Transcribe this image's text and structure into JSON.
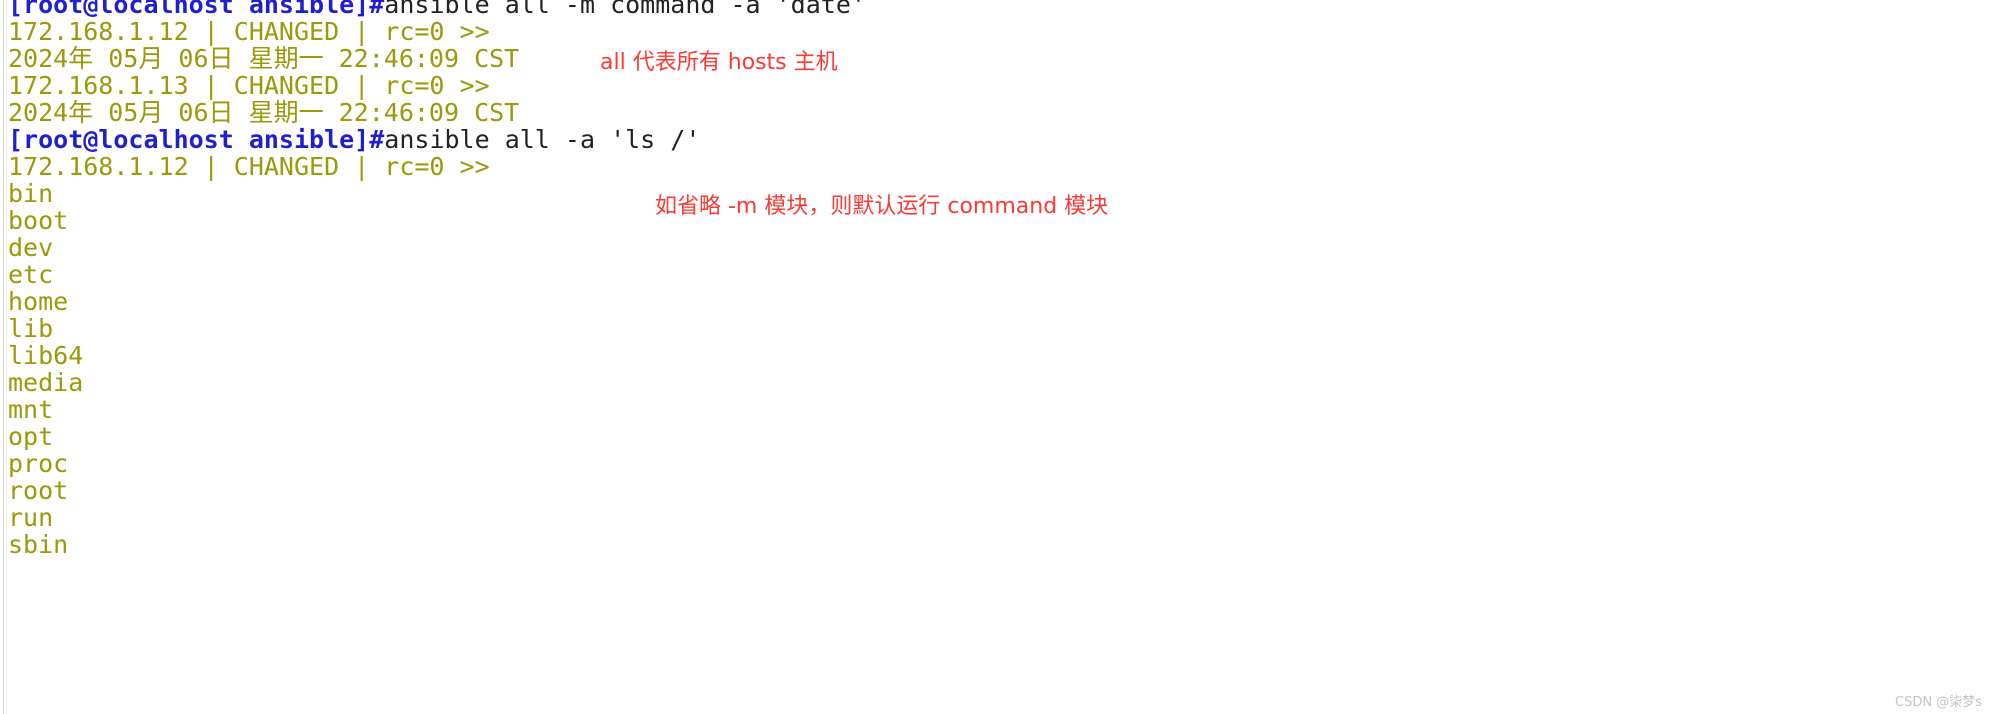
{
  "terminal": {
    "lines": [
      {
        "type": "prompt",
        "prompt": "[root@localhost ansible]#",
        "command": ""
      },
      {
        "type": "prompt",
        "prompt": "[root@localhost ansible]#",
        "command": "ansible all -m command -a 'date'"
      },
      {
        "type": "output",
        "text": "172.168.1.12 | CHANGED | rc=0 >>"
      },
      {
        "type": "output",
        "text": "2024年 05月 06日 星期一 22:46:09 CST"
      },
      {
        "type": "output",
        "text": "172.168.1.13 | CHANGED | rc=0 >>"
      },
      {
        "type": "output",
        "text": "2024年 05月 06日 星期一 22:46:09 CST"
      },
      {
        "type": "prompt",
        "prompt": "[root@localhost ansible]#",
        "command": "ansible all -a 'ls /'"
      },
      {
        "type": "output",
        "text": "172.168.1.12 | CHANGED | rc=0 >>"
      },
      {
        "type": "output",
        "text": "bin"
      },
      {
        "type": "output",
        "text": "boot"
      },
      {
        "type": "output",
        "text": "dev"
      },
      {
        "type": "output",
        "text": "etc"
      },
      {
        "type": "output",
        "text": "home"
      },
      {
        "type": "output",
        "text": "lib"
      },
      {
        "type": "output",
        "text": "lib64"
      },
      {
        "type": "output",
        "text": "media"
      },
      {
        "type": "output",
        "text": "mnt"
      },
      {
        "type": "output",
        "text": "opt"
      },
      {
        "type": "output",
        "text": "proc"
      },
      {
        "type": "output",
        "text": "root"
      },
      {
        "type": "output",
        "text": "run"
      },
      {
        "type": "output",
        "text": "sbin"
      }
    ]
  },
  "annotations": [
    {
      "text": "all 代表所有 hosts 主机"
    },
    {
      "text": "如省略 -m 模块，则默认运行 command 模块"
    }
  ],
  "watermark": {
    "text": "CSDN @柒梦s"
  },
  "colors": {
    "prompt": "#1f1fd0",
    "command": "#222222",
    "output": "#9a9a0a",
    "annotation": "#f83b36",
    "background": "#ffffff",
    "watermark": "#c4c4c4"
  }
}
